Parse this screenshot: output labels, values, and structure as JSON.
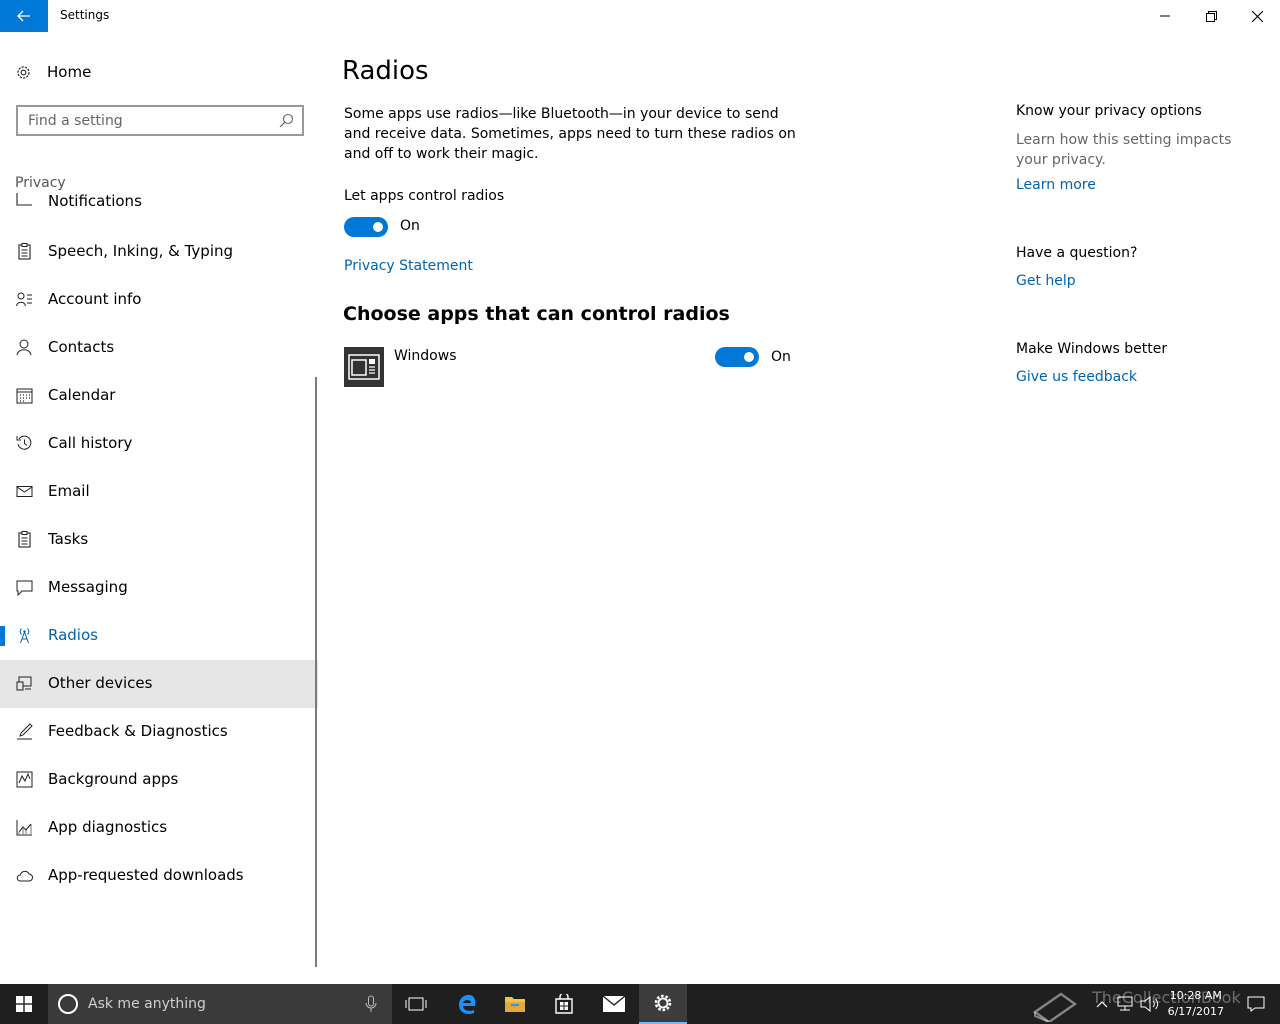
{
  "window": {
    "title": "Settings"
  },
  "sidebar": {
    "home_label": "Home",
    "search_placeholder": "Find a setting",
    "section_label": "Privacy",
    "items": [
      {
        "label": "Notifications",
        "icon": "notifications-icon"
      },
      {
        "label": "Speech, Inking, & Typing",
        "icon": "clipboard-icon"
      },
      {
        "label": "Account info",
        "icon": "account-info-icon"
      },
      {
        "label": "Contacts",
        "icon": "contacts-icon"
      },
      {
        "label": "Calendar",
        "icon": "calendar-icon"
      },
      {
        "label": "Call history",
        "icon": "history-icon"
      },
      {
        "label": "Email",
        "icon": "mail-icon"
      },
      {
        "label": "Tasks",
        "icon": "clipboard-icon"
      },
      {
        "label": "Messaging",
        "icon": "chat-bubble-icon"
      },
      {
        "label": "Radios",
        "icon": "radio-tower-icon"
      },
      {
        "label": "Other devices",
        "icon": "devices-icon"
      },
      {
        "label": "Feedback & Diagnostics",
        "icon": "feedback-icon"
      },
      {
        "label": "Background apps",
        "icon": "background-apps-icon"
      },
      {
        "label": "App diagnostics",
        "icon": "chart-icon"
      },
      {
        "label": "App-requested downloads",
        "icon": "cloud-icon"
      }
    ],
    "active_item": "Radios",
    "hovered_item": "Other devices"
  },
  "main": {
    "title": "Radios",
    "description": "Some apps use radios—like Bluetooth—in your device to send and receive data. Sometimes, apps need to turn these radios on and off to work their magic.",
    "let_apps_label": "Let apps control radios",
    "let_apps_state": "On",
    "privacy_link": "Privacy Statement",
    "choose_title": "Choose apps that can control radios",
    "apps": [
      {
        "name": "Windows",
        "state": "On",
        "icon": "windows-app-icon"
      }
    ]
  },
  "right": {
    "privacy_head": "Know your privacy options",
    "privacy_text": "Learn how this setting impacts your privacy.",
    "learn_more": "Learn more",
    "question_head": "Have a question?",
    "get_help": "Get help",
    "better_head": "Make Windows better",
    "feedback": "Give us feedback"
  },
  "taskbar": {
    "search_text": "Ask me anything",
    "time": "10:28 AM",
    "date": "6/17/2017",
    "watermark": "TheCollectionBook"
  },
  "colors": {
    "accent": "#0078d7",
    "link": "#0063b1",
    "taskbar": "#1f1f1f"
  }
}
